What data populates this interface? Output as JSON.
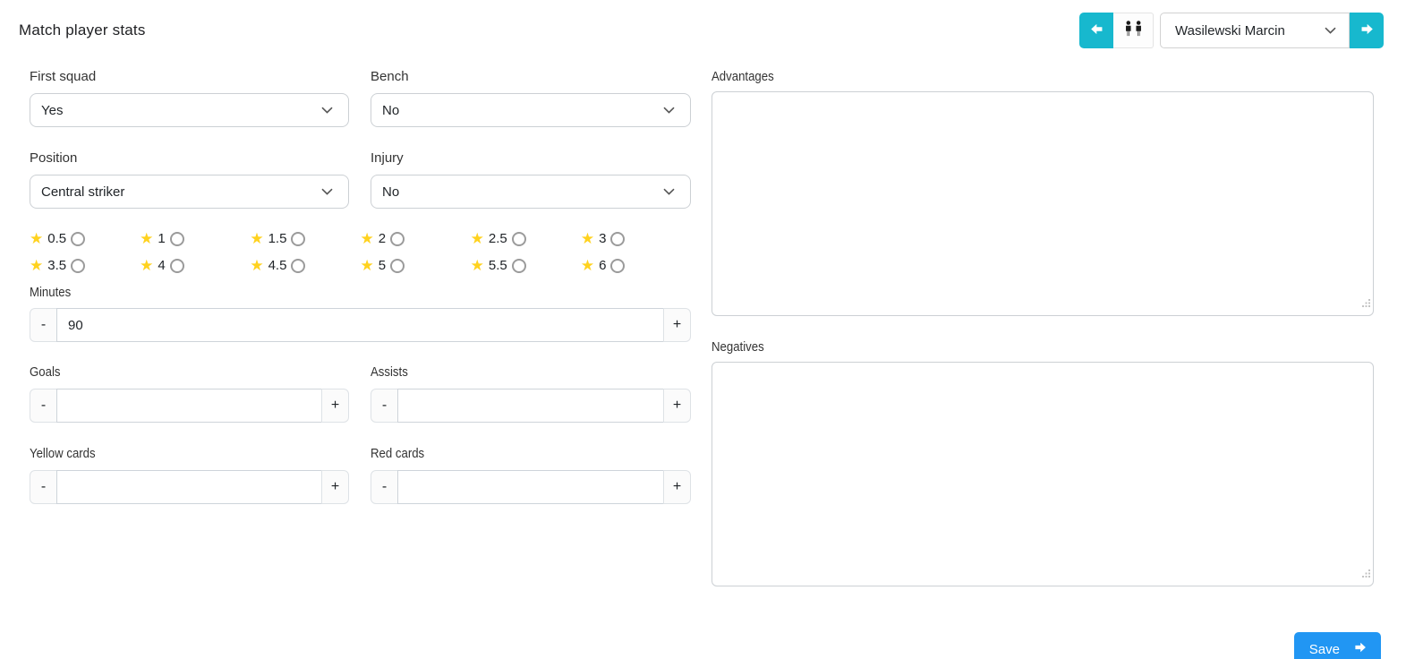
{
  "header": {
    "title": "Match player stats",
    "player_nav": {
      "prev_icon": "arrow-left",
      "team_icon": "players",
      "selected_player": "Wasilewski Marcin",
      "next_icon": "arrow-right"
    }
  },
  "form": {
    "first_squad": {
      "label": "First squad",
      "value": "Yes"
    },
    "bench": {
      "label": "Bench",
      "value": "No"
    },
    "position": {
      "label": "Position",
      "value": "Central striker"
    },
    "injury": {
      "label": "Injury",
      "value": "No"
    },
    "rating": {
      "options": [
        "0.5",
        "1",
        "1.5",
        "2",
        "2.5",
        "3",
        "3.5",
        "4",
        "4.5",
        "5",
        "5.5",
        "6"
      ],
      "selected": null
    },
    "minutes": {
      "label": "Minutes",
      "value": "90"
    },
    "goals": {
      "label": "Goals",
      "value": ""
    },
    "assists": {
      "label": "Assists",
      "value": ""
    },
    "yellow_cards": {
      "label": "Yellow cards",
      "value": ""
    },
    "red_cards": {
      "label": "Red cards",
      "value": ""
    },
    "advantages": {
      "label": "Advantages",
      "value": ""
    },
    "negatives": {
      "label": "Negatives",
      "value": ""
    },
    "stepper": {
      "minus": "-",
      "plus": "+"
    }
  },
  "footer": {
    "save_label": "Save"
  },
  "icons": {
    "star": "★"
  },
  "colors": {
    "accent_teal": "#17b8ce",
    "save_blue": "#2196f3",
    "star_yellow": "#ffd21e",
    "border_gray": "#ccd0d4"
  }
}
